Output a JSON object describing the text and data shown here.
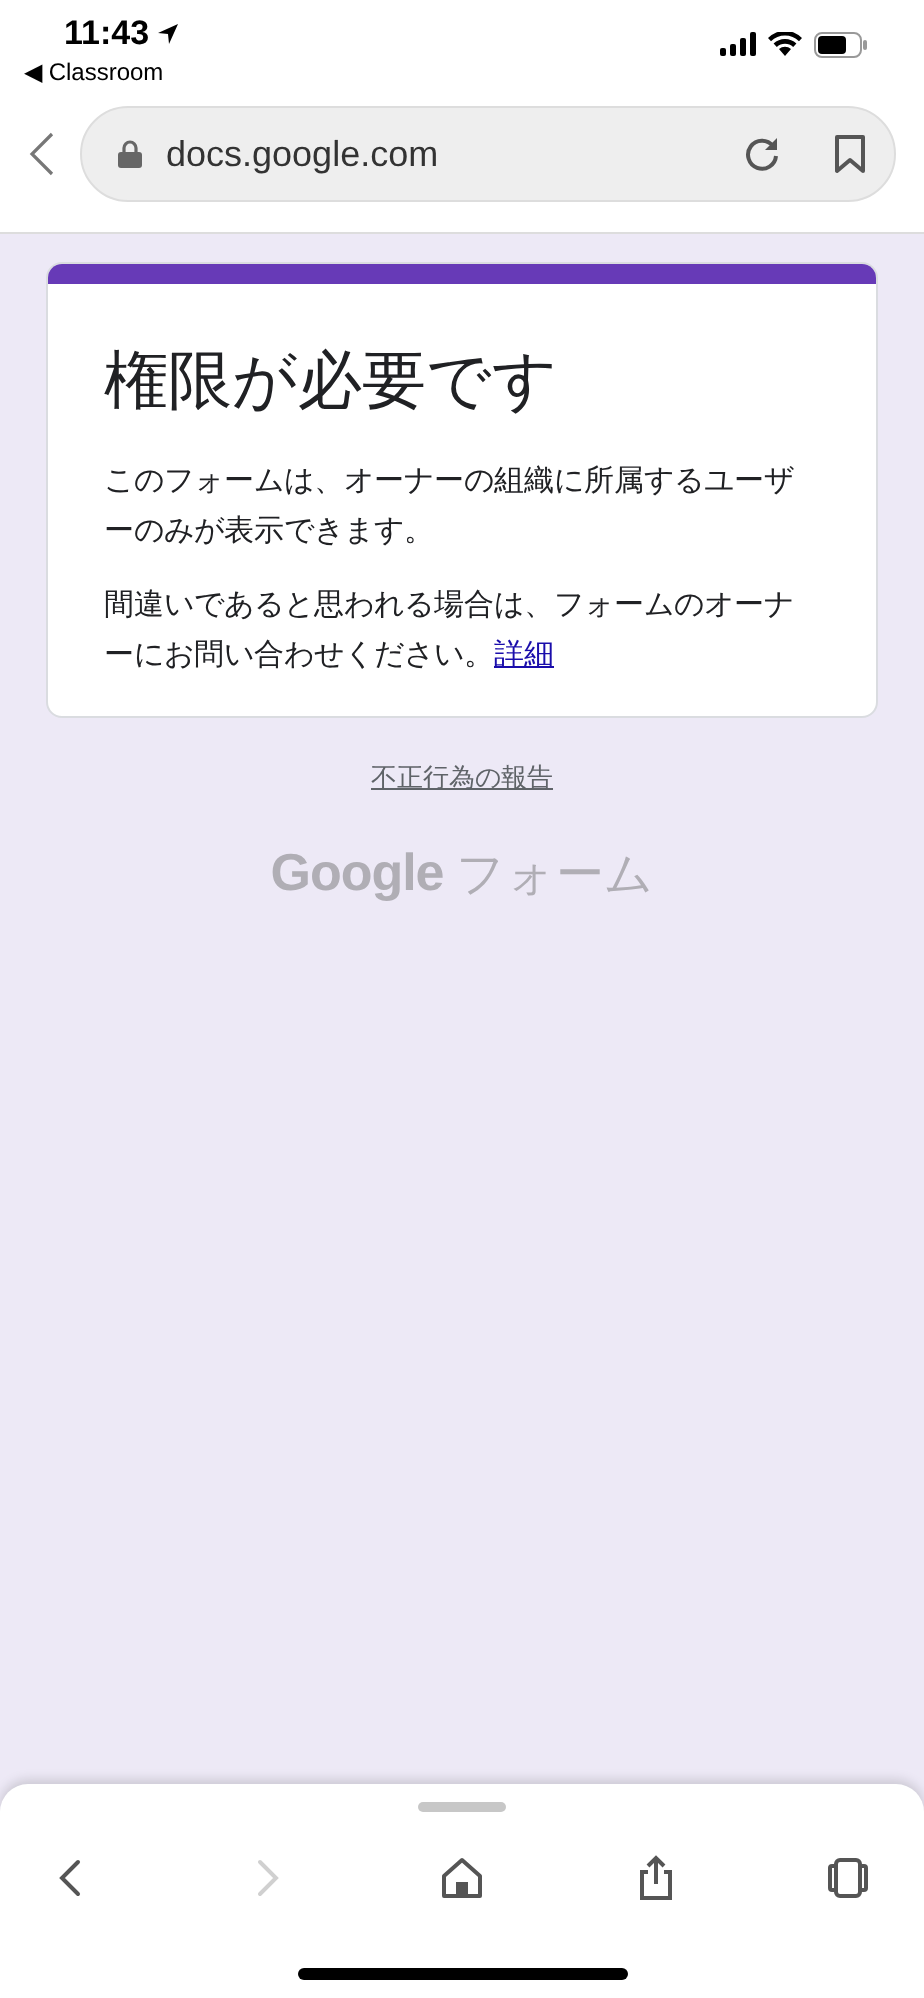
{
  "status_bar": {
    "time": "11:43",
    "back_app": "◀ Classroom"
  },
  "address_bar": {
    "url": "docs.google.com"
  },
  "card": {
    "title": "権限が必要です",
    "paragraphs": [
      "このフォームは、オーナーの組織に所属するユーザーのみが表示できます。",
      "間違いであると思われる場合は、フォームのオーナーにお問い合わせください。"
    ],
    "link": "詳細"
  },
  "report_link": "不正行為の報告",
  "logo": {
    "brand": "Google",
    "product": "フォーム"
  },
  "toolbar": [
    {
      "kind": "back",
      "disabled": false
    },
    {
      "kind": "forward",
      "disabled": true
    },
    {
      "kind": "home",
      "disabled": false
    },
    {
      "kind": "share",
      "disabled": false
    },
    {
      "kind": "tabs",
      "disabled": false
    }
  ]
}
